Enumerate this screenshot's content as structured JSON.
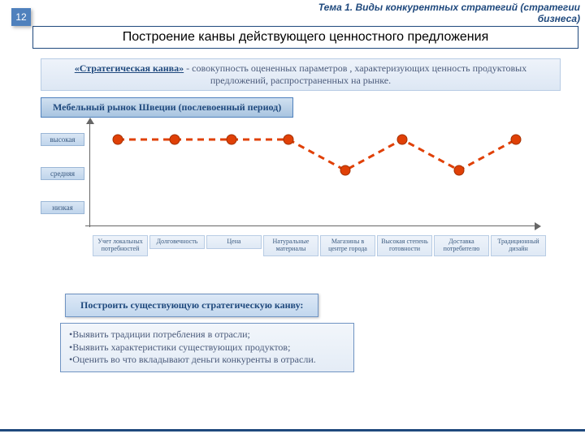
{
  "slide_number": "12",
  "topic": "Тема 1. Виды конкурентных стратегий (стратегии бизнеса)",
  "title": "Построение канвы действующего ценностного предложения",
  "definition": {
    "term": "«Стратегическая канва»",
    "text": " - совокупность оцененных параметров , характеризующих ценность продуктовых предложений, распространенных на рынке."
  },
  "subtitle": "Мебельный рынок Швеции (послевоенный период)",
  "y_labels": [
    "высокая",
    "средняя",
    "низкая"
  ],
  "chart_data": {
    "type": "line",
    "categories": [
      "Учет локальных потребностей",
      "Долговечность",
      "Цена",
      "Натуральные материалы",
      "Магазины в центре города",
      "Высокая степень готовности",
      "Доставка потребителю",
      "Традиционный дизайн"
    ],
    "series": [
      {
        "name": "Мебельный рынок Швеции",
        "levels": [
          "высокая",
          "высокая",
          "высокая",
          "высокая",
          "средняя",
          "высокая",
          "средняя",
          "высокая"
        ],
        "values": [
          3,
          3,
          3,
          3,
          2,
          3,
          2,
          3
        ]
      }
    ],
    "ylabels": [
      "низкая",
      "средняя",
      "высокая"
    ],
    "ylim": [
      1,
      3
    ]
  },
  "action_title": "Построить существующую стратегическую канву:",
  "bullets": [
    "Выявить традиции потребления в отрасли;",
    "Выявить характеристики существующих продуктов;",
    "Оценить во что вкладывают деньги конкуренты в отрасли."
  ]
}
